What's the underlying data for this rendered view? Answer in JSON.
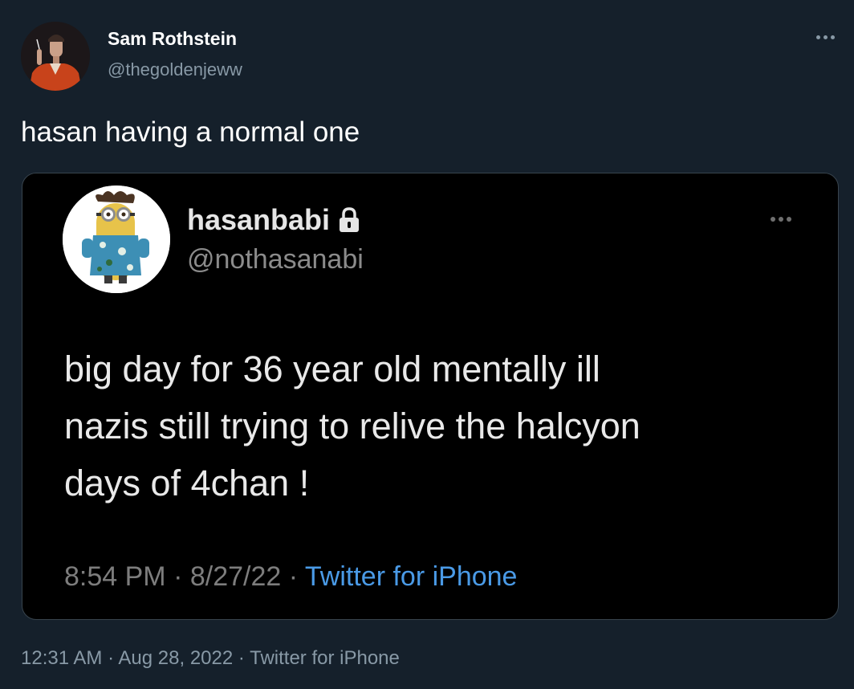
{
  "author": {
    "name": "Sam Rothstein",
    "handle": "@thegoldenjeww"
  },
  "tweet": {
    "text": "hasan having a normal one",
    "time": "12:31 AM",
    "date": "Aug 28, 2022",
    "source": "Twitter for iPhone",
    "separator": " · "
  },
  "embedded": {
    "name": "hasanbabi",
    "handle": "@nothasanabi",
    "lines": [
      "big day for 36 year old mentally ill",
      "nazis still trying to relive the halcyon",
      "days of 4chan !"
    ],
    "time": "8:54 PM",
    "date": "8/27/22",
    "source": "Twitter for iPhone",
    "separator": " · "
  },
  "icons": {
    "more": "more-horizontal-icon",
    "lock": "lock-icon"
  },
  "colors": {
    "background": "#15202b",
    "secondary_text": "#8899a6",
    "link": "#4a9ae6",
    "embed_background": "#000000"
  }
}
